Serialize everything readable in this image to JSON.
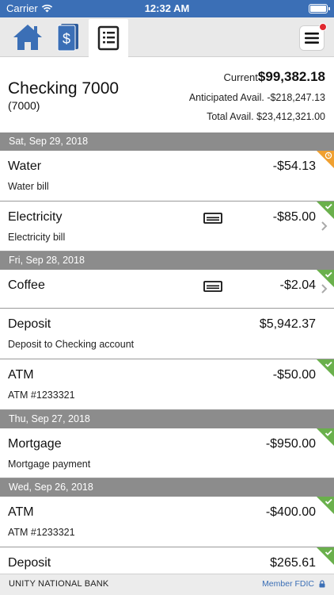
{
  "status_bar": {
    "carrier": "Carrier",
    "time": "12:32 AM"
  },
  "nav": {
    "icons": [
      "home-icon",
      "money-icon",
      "register-icon",
      "menu-icon"
    ],
    "accent": "#3b6fb6"
  },
  "account": {
    "name": "Checking 7000",
    "number": "(7000)",
    "current_label": "Current",
    "current_value": "$99,382.18",
    "anticipated_label": "Anticipated Avail.",
    "anticipated_value": "-$218,247.13",
    "total_label": "Total Avail.",
    "total_value": "$23,412,321.00"
  },
  "groups": [
    {
      "date": "Sat, Sep 29, 2018"
    },
    {
      "date": "Fri, Sep 28, 2018"
    },
    {
      "date": "Thu, Sep 27, 2018"
    },
    {
      "date": "Wed, Sep 26, 2018"
    }
  ],
  "transactions": [
    {
      "name": "Water",
      "amount": "-$54.13",
      "description": "Water bill",
      "status": "pending"
    },
    {
      "name": "Electricity",
      "amount": "-$85.00",
      "description": "Electricity bill",
      "status": "cleared"
    },
    {
      "name": "Coffee",
      "amount": "-$2.04",
      "description": "",
      "status": "cleared"
    },
    {
      "name": "Deposit",
      "amount": "$5,942.37",
      "description": "Deposit to Checking account",
      "status": "cleared"
    },
    {
      "name": "ATM",
      "amount": "-$50.00",
      "description": "ATM #1233321",
      "status": "cleared"
    },
    {
      "name": "Mortgage",
      "amount": "-$950.00",
      "description": "Mortgage payment",
      "status": "cleared"
    },
    {
      "name": "ATM",
      "amount": "-$400.00",
      "description": "ATM #1233321",
      "status": "cleared"
    },
    {
      "name": "Deposit",
      "amount": "$265.61",
      "description": "",
      "status": "cleared"
    }
  ],
  "colors": {
    "cleared": "#6ab04c",
    "pending": "#f0a030",
    "date_header": "#8c8c8c"
  },
  "footer": {
    "bank_name": "UNITY NATIONAL BANK",
    "fdic": "Member FDIC"
  }
}
